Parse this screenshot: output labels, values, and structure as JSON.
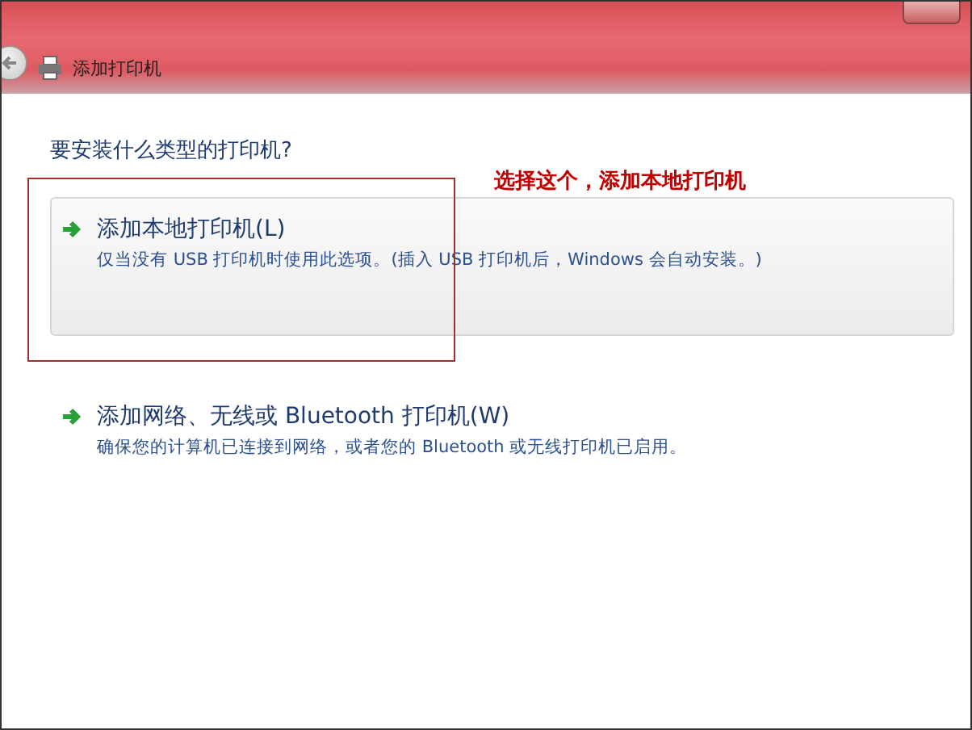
{
  "window": {
    "title": "添加打印机"
  },
  "question": "要安装什么类型的打印机?",
  "annotation": {
    "text": "选择这个，添加本地打印机"
  },
  "options": [
    {
      "title": "添加本地打印机(L)",
      "description": "仅当没有 USB 打印机时使用此选项。(插入 USB 打印机后，Windows 会自动安装。)",
      "selected": true
    },
    {
      "title": "添加网络、无线或 Bluetooth 打印机(W)",
      "description": "确保您的计算机已连接到网络，或者您的 Bluetooth 或无线打印机已启用。",
      "selected": false
    }
  ]
}
